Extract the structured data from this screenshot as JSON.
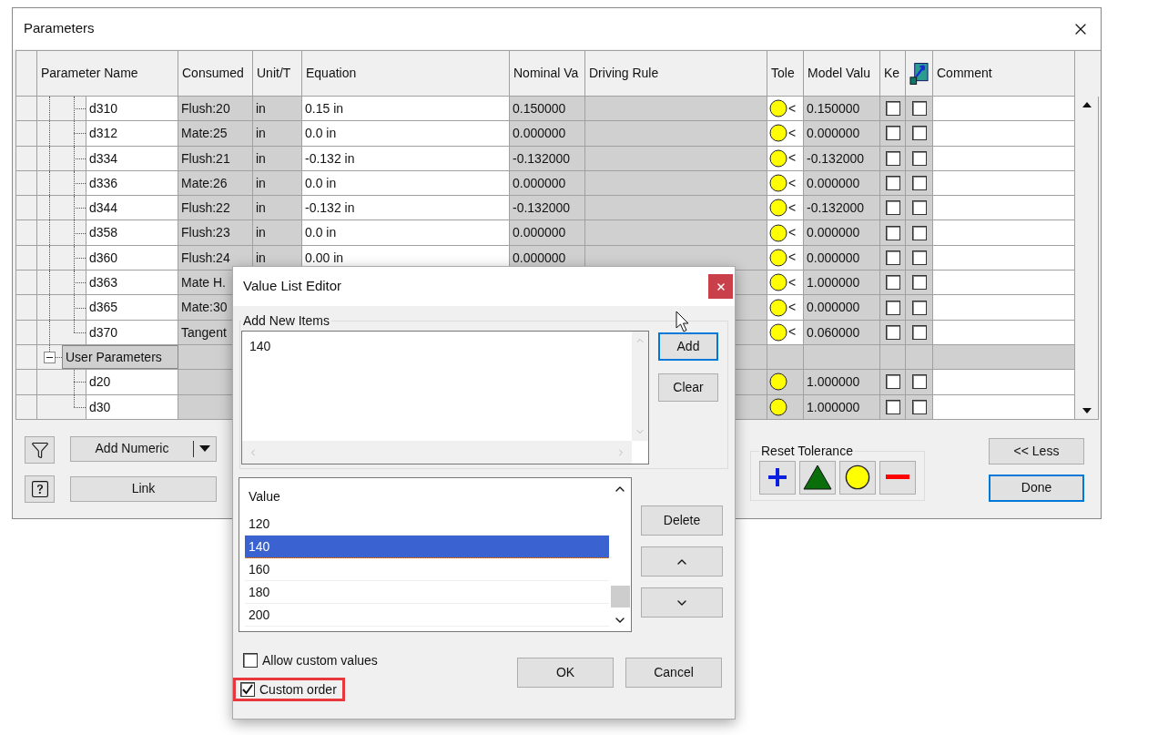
{
  "window": {
    "title": "Parameters"
  },
  "columns": [
    {
      "kind": "text",
      "label": "Parameter Name"
    },
    {
      "kind": "text",
      "label": "Consumed"
    },
    {
      "kind": "text",
      "label": "Unit/T"
    },
    {
      "kind": "text",
      "label": "Equation"
    },
    {
      "kind": "text",
      "label": "Nominal Va"
    },
    {
      "kind": "text",
      "label": "Driving Rule"
    },
    {
      "kind": "text",
      "label": "Tole"
    },
    {
      "kind": "text",
      "label": "Model Valu"
    },
    {
      "kind": "text",
      "label": "Ke"
    },
    {
      "kind": "icon"
    },
    {
      "kind": "text",
      "label": "Comment"
    }
  ],
  "groups": [
    {
      "children": [
        {
          "name": "d310",
          "consumed": "Flush:20",
          "unit": "in",
          "equation": "0.15 in",
          "nominal": "0.150000",
          "tol_sign": "<",
          "model_value": "0.150000",
          "key": false,
          "export": false
        },
        {
          "name": "d312",
          "consumed": "Mate:25",
          "unit": "in",
          "equation": "0.0 in",
          "nominal": "0.000000",
          "tol_sign": "<",
          "model_value": "0.000000",
          "key": false,
          "export": false
        },
        {
          "name": "d334",
          "consumed": "Flush:21",
          "unit": "in",
          "equation": "-0.132 in",
          "nominal": "-0.132000",
          "tol_sign": "<",
          "model_value": "-0.132000",
          "key": false,
          "export": false
        },
        {
          "name": "d336",
          "consumed": "Mate:26",
          "unit": "in",
          "equation": "0.0 in",
          "nominal": "0.000000",
          "tol_sign": "<",
          "model_value": "0.000000",
          "key": false,
          "export": false
        },
        {
          "name": "d344",
          "consumed": "Flush:22",
          "unit": "in",
          "equation": "-0.132 in",
          "nominal": "-0.132000",
          "tol_sign": "<",
          "model_value": "-0.132000",
          "key": false,
          "export": false
        },
        {
          "name": "d358",
          "consumed": "Flush:23",
          "unit": "in",
          "equation": "0.0 in",
          "nominal": "0.000000",
          "tol_sign": "<",
          "model_value": "0.000000",
          "key": false,
          "export": false
        },
        {
          "name": "d360",
          "consumed": "Flush:24",
          "unit": "in",
          "equation": "0.00 in",
          "nominal": "0.000000",
          "tol_sign": "<",
          "model_value": "0.000000",
          "key": false,
          "export": false
        },
        {
          "name": "d363",
          "consumed": "Mate H.",
          "tol_sign": "<",
          "model_value": "1.000000",
          "key": false,
          "export": false
        },
        {
          "name": "d365",
          "consumed": "Mate:30",
          "tol_sign": "<",
          "model_value": "0.000000",
          "key": false,
          "export": false
        },
        {
          "name": "d370",
          "consumed": "Tangent",
          "tol_sign": "<",
          "model_value": "0.060000",
          "key": false,
          "export": false
        }
      ]
    },
    {
      "label": "User Parameters",
      "expanded": true,
      "children": [
        {
          "name": "d20",
          "model_value": "1.000000",
          "key": false,
          "export": false
        },
        {
          "name": "d30",
          "model_value": "1.000000",
          "key": false,
          "export": false
        }
      ]
    }
  ],
  "bottom": {
    "add_numeric": "Add Numeric",
    "link": "Link",
    "reset_tolerance": "Reset Tolerance",
    "less": "<< Less",
    "done": "Done",
    "done_focused": true
  },
  "dialog": {
    "title": "Value List Editor",
    "add_new_items": {
      "label": "Add New Items",
      "value": "140"
    },
    "side_buttons": [
      {
        "label": "Add",
        "focused": true
      },
      {
        "label": "Clear",
        "focused": false
      }
    ],
    "list": {
      "header": "Value",
      "items": [
        {
          "value": "120",
          "selected": false
        },
        {
          "value": "140",
          "selected": true
        },
        {
          "value": "160",
          "selected": false
        },
        {
          "value": "180",
          "selected": false
        },
        {
          "value": "200",
          "selected": false
        }
      ]
    },
    "delete": "Delete",
    "options": [
      {
        "label": "Allow custom values",
        "checked": false,
        "highlighted": false
      },
      {
        "label": "Custom order",
        "checked": true,
        "highlighted": true
      }
    ],
    "ok": "OK",
    "cancel": "Cancel"
  }
}
